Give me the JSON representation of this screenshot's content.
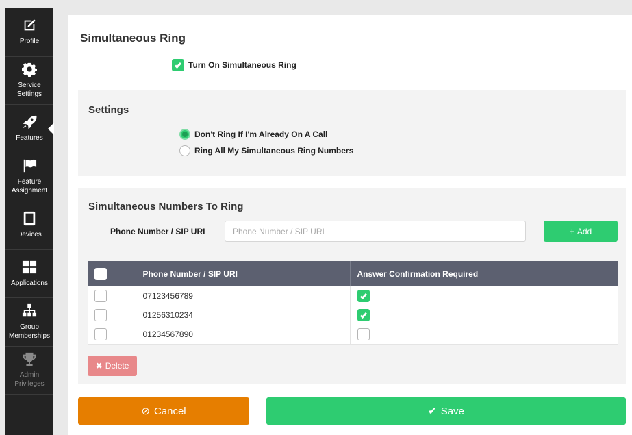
{
  "sidebar": {
    "items": [
      {
        "label": "Profile",
        "icon": "edit-icon"
      },
      {
        "label": "Service Settings",
        "icon": "gear-icon"
      },
      {
        "label": "Features",
        "icon": "rocket-icon"
      },
      {
        "label": "Feature Assignment",
        "icon": "flag-icon"
      },
      {
        "label": "Devices",
        "icon": "device-icon"
      },
      {
        "label": "Applications",
        "icon": "grid-icon"
      },
      {
        "label": "Group Memberships",
        "icon": "sitemap-icon"
      },
      {
        "label": "Admin Privileges",
        "icon": "trophy-icon"
      }
    ],
    "active": "Features"
  },
  "page": {
    "title": "Simultaneous Ring",
    "toggle_label": "Turn On Simultaneous Ring",
    "toggle_checked": true
  },
  "settings": {
    "title": "Settings",
    "options": [
      {
        "label": "Don't Ring If I'm Already On A Call",
        "selected": true
      },
      {
        "label": "Ring All My Simultaneous Ring Numbers",
        "selected": false
      }
    ]
  },
  "numbers": {
    "title": "Simultaneous Numbers To Ring",
    "field_label": "Phone Number / SIP URI",
    "input_placeholder": "Phone Number / SIP URI",
    "add_label": "Add",
    "columns": [
      "Phone Number / SIP URI",
      "Answer Confirmation Required"
    ],
    "rows": [
      {
        "number": "07123456789",
        "confirm": true
      },
      {
        "number": "01256310234",
        "confirm": true
      },
      {
        "number": "01234567890",
        "confirm": false
      }
    ],
    "delete_label": "Delete"
  },
  "actions": {
    "cancel_label": "Cancel",
    "save_label": "Save"
  },
  "colors": {
    "accent_green": "#2ecc71",
    "cancel_orange": "#e67e00",
    "delete_red": "#e8888a",
    "table_header": "#5c6070",
    "sidebar_bg": "#232323"
  }
}
